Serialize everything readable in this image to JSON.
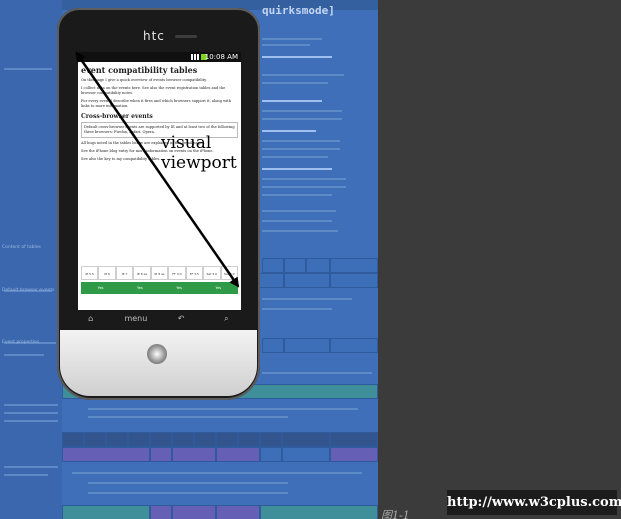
{
  "background_page": {
    "top_bar": "",
    "site_title": "quirksmode]",
    "nav": "",
    "right_link_text": "",
    "grid_labels": [
      "Content of tables",
      "Default browser events",
      "Event properties"
    ]
  },
  "phone": {
    "brand": "htc",
    "status_time": "10:08 AM",
    "bottom_keys": [
      "⌂",
      "menu",
      "↶",
      "⌕"
    ],
    "screen": {
      "heading": "event compatibility tables",
      "paragraphs": [
        "On this page I give a quick overview of events browser compatibility.",
        "I collect data on the events here. See also the event registration tables and the browser compatibility notes.",
        "For every event I describe when it fires and which browsers support it, along with links to more information."
      ],
      "section_heading": "Cross-browser events",
      "box_text": "Default cross-browser events are supported by IE and at least two of the following three browsers: Firefox, Safari, Opera.",
      "after_box": [
        "All bugs noted in the tables below are explained in the detail pages.",
        "See the iPhone blog entry for more information on events on the iPhone.",
        "See also the key to my compatibility tables."
      ],
      "table_headers": [
        "IE 5.5",
        "IE 6",
        "IE 7",
        "IE 8 as IE7",
        "IE 8 as IE8",
        "FF 3.0",
        "FF 3.5",
        "Saf 3.0",
        "Saf 4.0"
      ],
      "table_bar": [
        "Yes",
        "Yes",
        "Yes",
        "Yes"
      ]
    }
  },
  "annotation": {
    "label": "visual viewport"
  },
  "caption": "图1-1",
  "watermark": "http://www.w3cplus.com"
}
